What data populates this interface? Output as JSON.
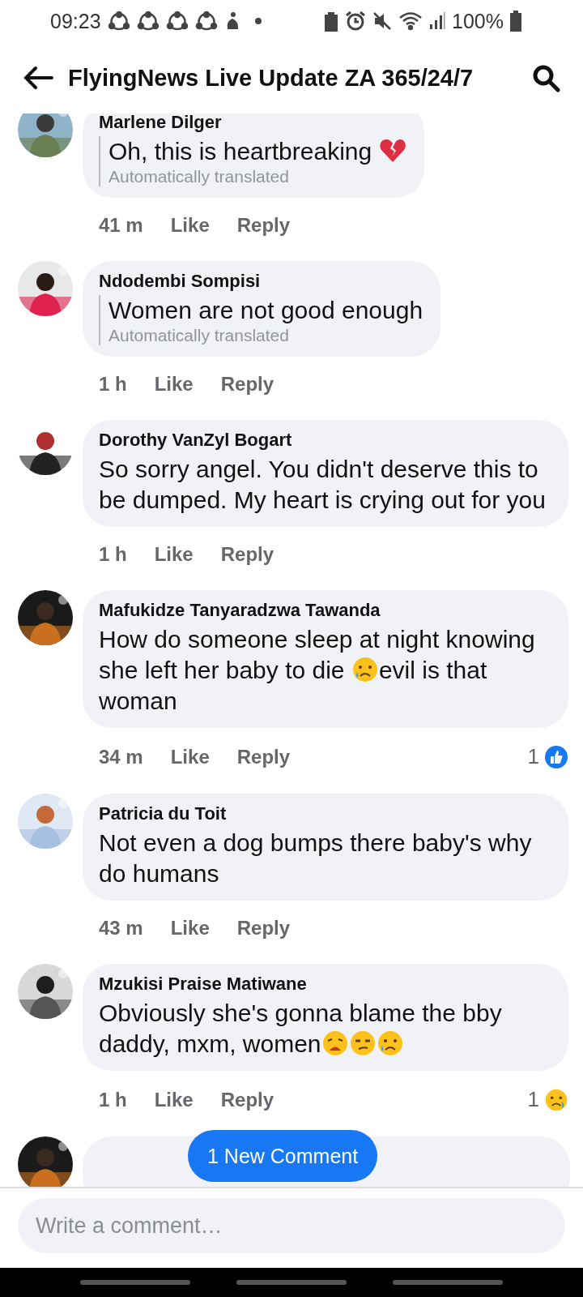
{
  "status_bar": {
    "time": "09:23",
    "battery": "100%"
  },
  "header": {
    "title": "FlyingNews Live Update ZA 365/24/7"
  },
  "comments": [
    {
      "author": "Marlene Dilger",
      "body": [
        {
          "kind": "text",
          "text": "Oh, this is heartbreaking "
        },
        {
          "kind": "heartbreak"
        }
      ],
      "translated": "Automatically translated",
      "time": "41 m",
      "like": "Like",
      "reply": "Reply"
    },
    {
      "author": "Ndodembi Sompisi",
      "body": [
        {
          "kind": "text",
          "text": "Women are not good enough"
        }
      ],
      "translated": "Automatically translated",
      "time": "1 h",
      "like": "Like",
      "reply": "Reply"
    },
    {
      "author": "Dorothy VanZyl Bogart",
      "body": [
        {
          "kind": "text",
          "text": "So sorry angel. You didn't deserve this to be dumped. My heart is crying out for you"
        }
      ],
      "time": "1 h",
      "like": "Like",
      "reply": "Reply"
    },
    {
      "author": "Mafukidze Tanyaradzwa Tawanda",
      "body": [
        {
          "kind": "text",
          "text": "How do someone sleep at night knowing she left her baby to die "
        },
        {
          "kind": "crying"
        },
        {
          "kind": "text",
          "text": "evil is that woman"
        }
      ],
      "time": "34 m",
      "like": "Like",
      "reply": "Reply",
      "reaction": {
        "count": "1",
        "kind": "like"
      }
    },
    {
      "author": "Patricia du Toit",
      "body": [
        {
          "kind": "text",
          "text": "Not even a dog bumps there baby's why do humans"
        }
      ],
      "time": "43 m",
      "like": "Like",
      "reply": "Reply"
    },
    {
      "author": "Mzukisi Praise Matiwane",
      "body": [
        {
          "kind": "text",
          "text": "Obviously she's gonna blame the bby daddy,  mxm, women"
        },
        {
          "kind": "weary"
        },
        {
          "kind": "unamused"
        },
        {
          "kind": "crying"
        }
      ],
      "time": "1 h",
      "like": "Like",
      "reply": "Reply",
      "reaction": {
        "count": "1",
        "kind": "sad"
      }
    }
  ],
  "new_comment_button": "1 New Comment",
  "composer": {
    "placeholder": "Write a comment…"
  }
}
